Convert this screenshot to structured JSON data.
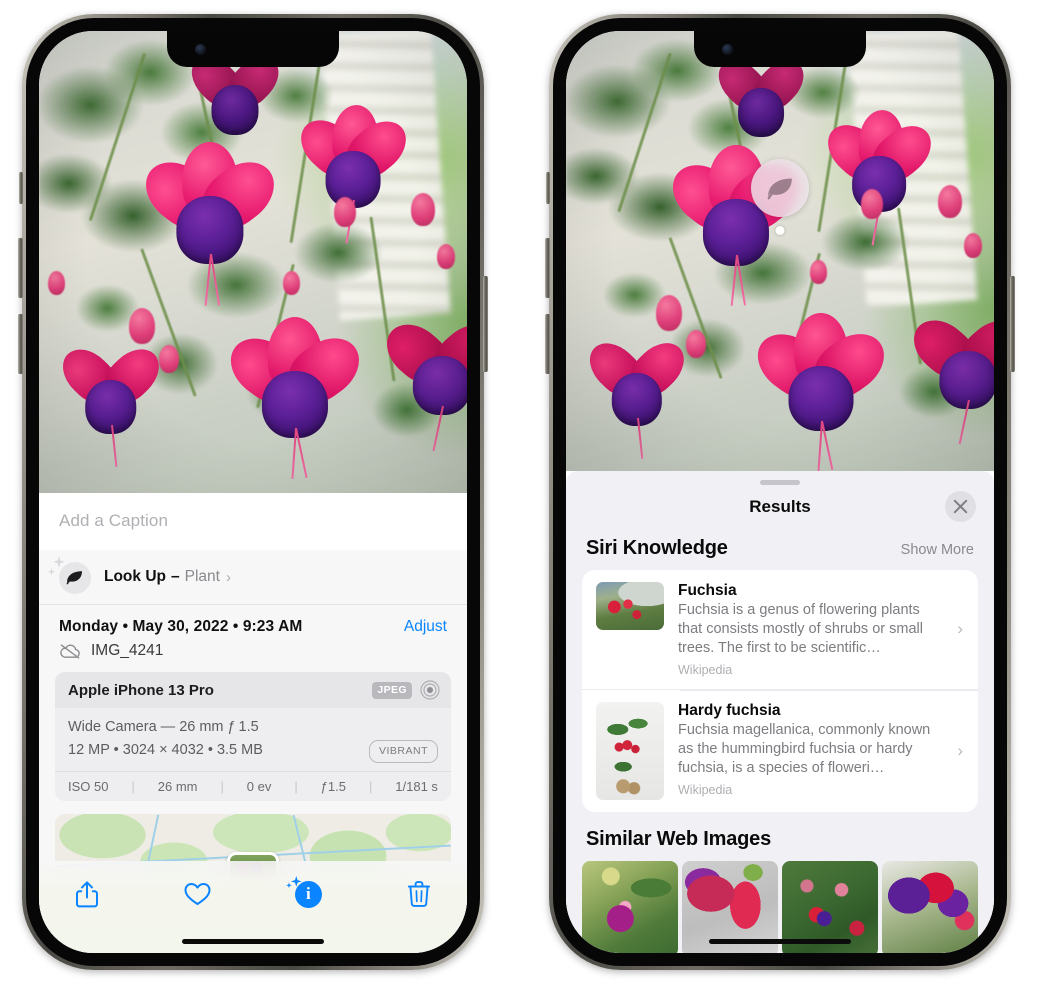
{
  "left_phone": {
    "photo_alt": "fuchsia-flowers-photo",
    "caption_placeholder": "Add a Caption",
    "lookup": {
      "icon": "leaf-icon",
      "label": "Look Up",
      "dash": "–",
      "subject": "Plant",
      "chevron": "›"
    },
    "date_line": "Monday • May 30, 2022 • 9:23 AM",
    "adjust_label": "Adjust",
    "cloud_icon": "icloud-slash-icon",
    "file_name": "IMG_4241",
    "exif": {
      "model": "Apple iPhone 13 Pro",
      "format_badge": "JPEG",
      "lens_icon": "aperture-icon",
      "lens_line": "Wide Camera — 26 mm ƒ 1.5",
      "specs_line": "12 MP • 3024 × 4032 • 3.5 MB",
      "vibrant_badge": "VIBRANT",
      "stats": [
        "ISO 50",
        "26 mm",
        "0 ev",
        "ƒ1.5",
        "1/181 s"
      ]
    },
    "toolbar": {
      "share": "share-icon",
      "favorite": "heart-icon",
      "info": "info-icon",
      "info_glyph": "i",
      "trash": "trash-icon"
    }
  },
  "right_phone": {
    "visual_lookup_badge": "leaf-icon",
    "sheet": {
      "title": "Results",
      "close_label": "×"
    },
    "siri_knowledge": {
      "heading": "Siri Knowledge",
      "show_more": "Show More",
      "items": [
        {
          "title": "Fuchsia",
          "description": "Fuchsia is a genus of flowering plants that consists mostly of shrubs or small trees. The first to be scientific…",
          "source": "Wikipedia",
          "chevron": "›"
        },
        {
          "title": "Hardy fuchsia",
          "description": "Fuchsia magellanica, commonly known as the hummingbird fuchsia or hardy fuchsia, is a species of floweri…",
          "source": "Wikipedia",
          "chevron": "›"
        }
      ]
    },
    "similar_web_images": {
      "heading": "Similar Web Images",
      "thumbs": [
        "fuchsia-thumb-1",
        "fuchsia-thumb-2",
        "fuchsia-thumb-3",
        "fuchsia-thumb-4"
      ]
    }
  },
  "colors": {
    "accent_blue": "#0a84ff",
    "sheet_bg": "#f1f1f5",
    "card_bg": "#ffffff",
    "secondary_text": "#8a8a8e"
  }
}
